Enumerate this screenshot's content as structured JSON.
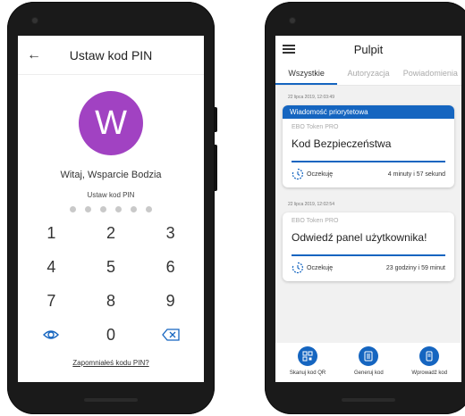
{
  "left_screen": {
    "header": {
      "title": "Ustaw kod PIN",
      "back_icon": "back-arrow-icon"
    },
    "avatar_initial": "W",
    "avatar_color": "#a142c2",
    "greeting": "Witaj, Wsparcie Bodzia",
    "pin_label": "Ustaw kod PIN",
    "keypad": {
      "k1": "1",
      "k2": "2",
      "k3": "3",
      "k4": "4",
      "k5": "5",
      "k6": "6",
      "k7": "7",
      "k8": "8",
      "k9": "9",
      "k0": "0",
      "left_icon": "eye-icon",
      "right_icon": "backspace-icon"
    },
    "forgot_link": "Zapomniałeś kodu PIN?"
  },
  "right_screen": {
    "header": {
      "title": "Pulpit",
      "menu_icon": "hamburger-menu-icon"
    },
    "tabs": [
      "Wszystkie",
      "Autoryzacja",
      "Powiadomienia"
    ],
    "active_tab": "Wszystkie",
    "accent_color": "#1565c0",
    "notifications": [
      {
        "timestamp": "22 lipca 2019, 12:03:49",
        "priority_label": "Wiadomość priorytetowa",
        "source": "EBO Token PRO",
        "title": "Kod Bezpieczeństwa",
        "status": "Oczekuję",
        "remaining": "4 minuty i 57 sekund"
      },
      {
        "timestamp": "22 lipca 2019, 12:02:54",
        "source": "EBO Token PRO",
        "title": "Odwiedź panel użytkownika!",
        "status": "Oczekuję",
        "remaining": "23 godziny i 59 minut"
      }
    ],
    "bottom_actions": [
      {
        "label": "Skanuj kod QR",
        "icon": "qr-scan-icon"
      },
      {
        "label": "Generuj kod",
        "icon": "generate-code-icon"
      },
      {
        "label": "Wprowadź kod",
        "icon": "enter-code-icon"
      }
    ]
  }
}
